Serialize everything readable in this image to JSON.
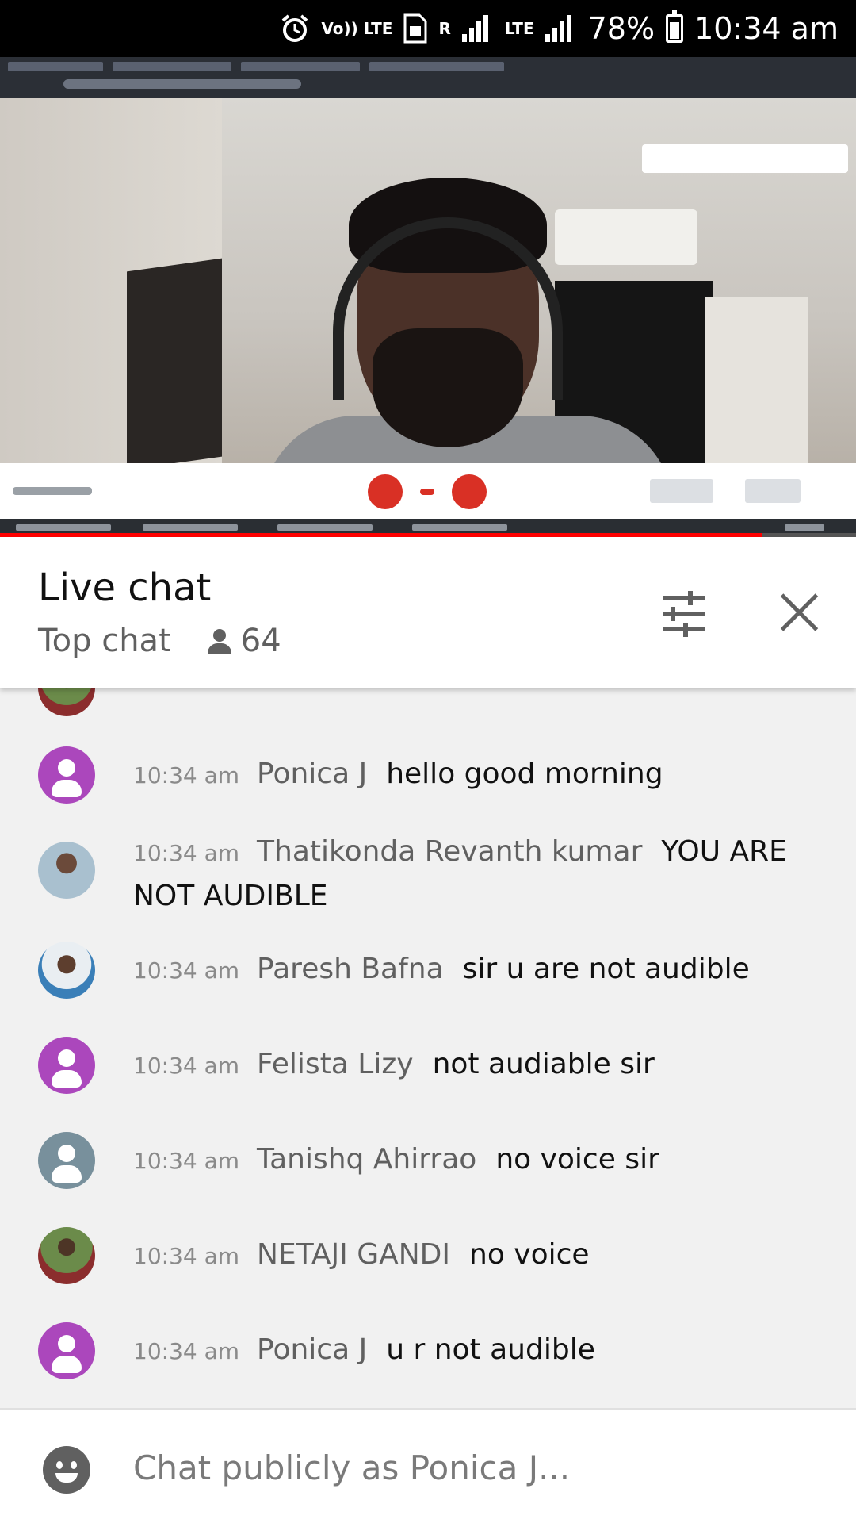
{
  "status_bar": {
    "volte_label": "Vo)) LTE",
    "roaming_label": "R",
    "lte_label": "LTE",
    "battery_text": "78%",
    "time": "10:34 am"
  },
  "video": {
    "progress_fraction": 0.89
  },
  "chat": {
    "title": "Live chat",
    "mode": "Top chat",
    "viewer_count": "64",
    "messages": [
      {
        "time": "10:34 am",
        "author": "Ponica J",
        "text": "hello good morning",
        "avatar": "default-purple"
      },
      {
        "time": "10:34 am",
        "author": "Thatikonda Revanth kumar",
        "text": "YOU ARE NOT AUDIBLE",
        "avatar": "photo"
      },
      {
        "time": "10:34 am",
        "author": "Paresh Bafna",
        "text": "sir u are not audible",
        "avatar": "photo"
      },
      {
        "time": "10:34 am",
        "author": "Felista Lizy",
        "text": "not audiable sir",
        "avatar": "default-purple"
      },
      {
        "time": "10:34 am",
        "author": "Tanishq Ahirrao",
        "text": "no voice sir",
        "avatar": "default-grey"
      },
      {
        "time": "10:34 am",
        "author": "NETAJI GANDI",
        "text": "no voice",
        "avatar": "photo"
      },
      {
        "time": "10:34 am",
        "author": "Ponica J",
        "text": "u r not audible",
        "avatar": "default-purple"
      }
    ],
    "input_placeholder": "Chat publicly as Ponica J...",
    "icons": {
      "filter": "tune-icon",
      "close": "close-icon",
      "emoji": "emoji-icon",
      "viewers": "person-icon"
    },
    "colors": {
      "progress": "#ff0000",
      "default_avatar_purple": "#ab47bc",
      "default_avatar_grey": "#78909c"
    }
  }
}
